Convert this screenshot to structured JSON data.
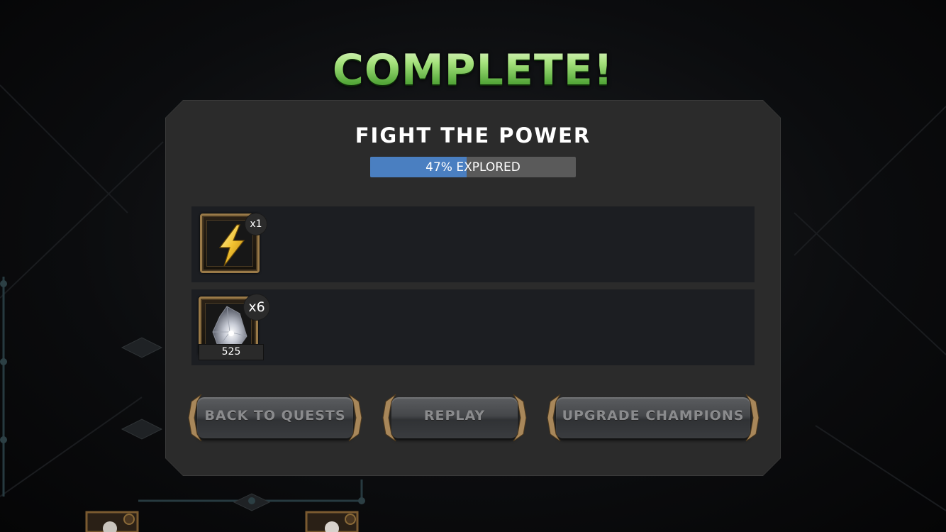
{
  "screen_title": "COMPLETE!",
  "quest": {
    "name": "FIGHT THE POWER",
    "progress_percent": 47,
    "progress_text": "47% EXPLORED"
  },
  "rewards": [
    {
      "icon": "energy-bolt-icon",
      "quantity": "x1"
    },
    {
      "icon": "crystal-shard-icon",
      "quantity": "x6",
      "amount": "525"
    }
  ],
  "buttons": {
    "back_to_quests": "BACK TO QUESTS",
    "replay": "REPLAY",
    "upgrade_champions": "UPGRADE CHAMPIONS"
  },
  "colors": {
    "title_green": "#8fdc6a",
    "progress_fill": "#4a7fc1",
    "frame_gold": "#9a7a48"
  }
}
